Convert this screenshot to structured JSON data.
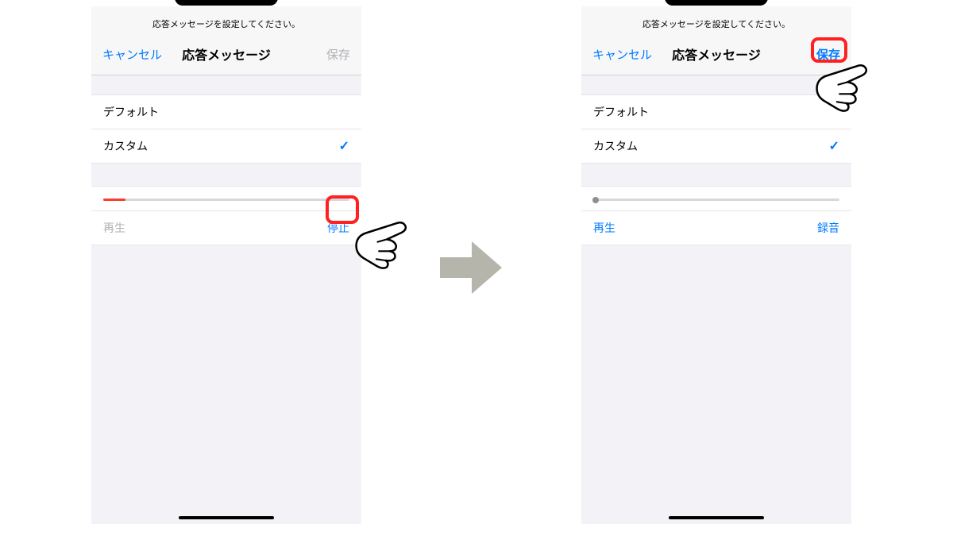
{
  "instruction": "応答メッセージを設定してください。",
  "nav": {
    "cancel": "キャンセル",
    "title": "応答メッセージ",
    "save": "保存"
  },
  "options": {
    "default": "デフォルト",
    "custom": "カスタム"
  },
  "left": {
    "progress_percent": 9,
    "play": "再生",
    "stop": "停止"
  },
  "right": {
    "play": "再生",
    "record": "録音"
  },
  "colors": {
    "accent": "#007aff",
    "red": "#ff3b30",
    "highlight": "#ff2020"
  }
}
